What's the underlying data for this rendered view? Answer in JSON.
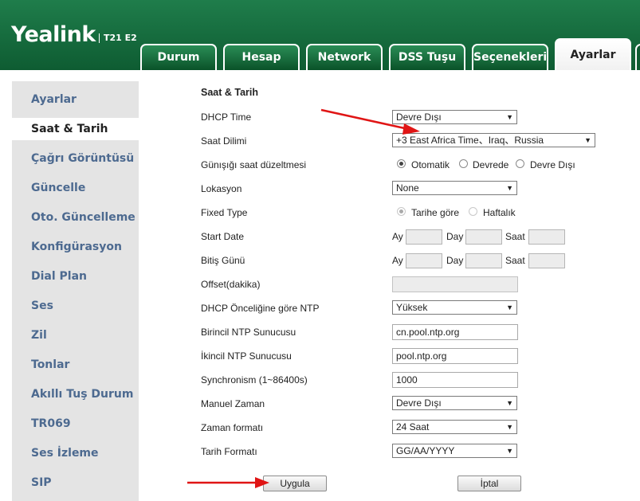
{
  "header": {
    "logo": "Yealink",
    "model": "T21 E2",
    "tabs": [
      {
        "label": "Durum"
      },
      {
        "label": "Hesap"
      },
      {
        "label": "Network"
      },
      {
        "label": "DSS Tuşu"
      },
      {
        "label": "Seçenekleri"
      },
      {
        "label": "Ayarlar",
        "active": true
      }
    ]
  },
  "sidebar": {
    "items": [
      {
        "label": "Ayarlar"
      },
      {
        "label": "Saat & Tarih",
        "active": true
      },
      {
        "label": "Çağrı Görüntüsü"
      },
      {
        "label": "Güncelle"
      },
      {
        "label": "Oto. Güncelleme"
      },
      {
        "label": "Konfigürasyon"
      },
      {
        "label": "Dial Plan"
      },
      {
        "label": "Ses"
      },
      {
        "label": "Zil"
      },
      {
        "label": "Tonlar"
      },
      {
        "label": "Akıllı Tuş Durum"
      },
      {
        "label": "TR069"
      },
      {
        "label": "Ses İzleme"
      },
      {
        "label": "SIP"
      }
    ]
  },
  "form": {
    "title": "Saat & Tarih",
    "dhcp_time": {
      "label": "DHCP Time",
      "value": "Devre Dışı"
    },
    "time_zone": {
      "label": "Saat Dilimi",
      "value": "+3 East Africa Time、Iraq、Russia"
    },
    "dst": {
      "label": "Günışığı saat düzeltmesi",
      "options": [
        "Otomatik",
        "Devrede",
        "Devre Dışı"
      ],
      "selected": "Otomatik"
    },
    "location": {
      "label": "Lokasyon",
      "value": "None"
    },
    "fixed_type": {
      "label": "Fixed Type",
      "options": [
        "Tarihe göre",
        "Haftalık"
      ],
      "selected": "Tarihe göre"
    },
    "start_date": {
      "label": "Start Date"
    },
    "end_date": {
      "label": "Bitiş Günü"
    },
    "date_parts": {
      "month": "Ay",
      "day": "Day",
      "hour": "Saat"
    },
    "offset": {
      "label": "Offset(dakika)",
      "value": ""
    },
    "dhcp_ntp": {
      "label": "DHCP Önceliğine göre NTP",
      "value": "Yüksek"
    },
    "ntp_primary": {
      "label": "Birincil NTP Sunucusu",
      "value": "cn.pool.ntp.org"
    },
    "ntp_secondary": {
      "label": "İkincil NTP Sunucusu",
      "value": "pool.ntp.org"
    },
    "sync": {
      "label": "Synchronism (1~86400s)",
      "value": "1000"
    },
    "manual_time": {
      "label": "Manuel Zaman",
      "value": "Devre Dışı"
    },
    "time_format": {
      "label": "Zaman formatı",
      "value": "24 Saat"
    },
    "date_format": {
      "label": "Tarih Formatı",
      "value": "GG/AA/YYYY"
    },
    "apply_label": "Uygula",
    "cancel_label": "İptal"
  },
  "colors": {
    "header_green": "#0e5c32",
    "sidebar_text": "#4d6a90",
    "annotation_arrow": "#e01515"
  }
}
